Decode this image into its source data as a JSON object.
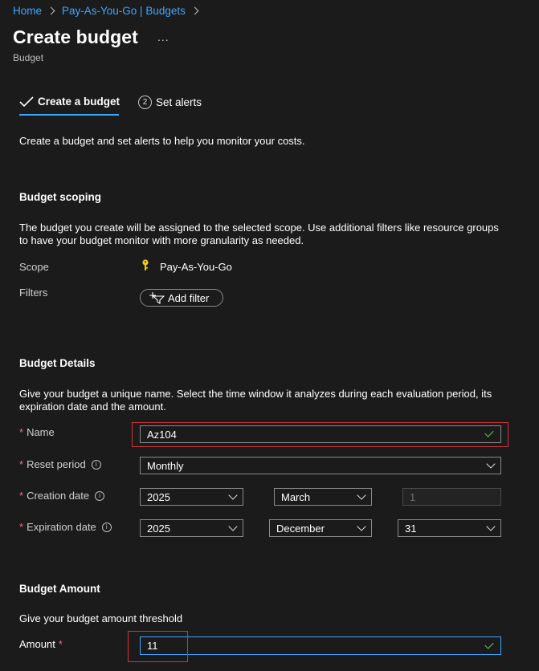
{
  "breadcrumb": {
    "items": [
      "Home",
      "Pay-As-You-Go | Budgets"
    ]
  },
  "header": {
    "title": "Create budget",
    "more": "...",
    "subtitle": "Budget"
  },
  "tabs": [
    {
      "label": "Create a budget",
      "state": "completed"
    },
    {
      "label": "Set alerts",
      "step": "2"
    }
  ],
  "intro": "Create a budget and set alerts to help you monitor your costs.",
  "scoping": {
    "heading": "Budget scoping",
    "description": "The budget you create will be assigned to the selected scope. Use additional filters like resource groups to have your budget monitor with more granularity as needed.",
    "scope_label": "Scope",
    "scope_value": "Pay-As-You-Go",
    "scope_icon": "key-icon",
    "filters_label": "Filters",
    "add_filter_label": "Add filter"
  },
  "details": {
    "heading": "Budget Details",
    "description": "Give your budget a unique name. Select the time window it analyzes during each evaluation period, its expiration date and the amount.",
    "name_label": "Name",
    "name_value": "Az104",
    "reset_label": "Reset period",
    "reset_value": "Monthly",
    "creation_label": "Creation date",
    "creation_year": "2025",
    "creation_month": "March",
    "creation_day": "1",
    "expiration_label": "Expiration date",
    "expiration_year": "2025",
    "expiration_month": "December",
    "expiration_day": "31",
    "required_mark": "*",
    "info_glyph": "i"
  },
  "amount": {
    "heading": "Budget Amount",
    "description": "Give your budget amount threshold",
    "label": "Amount",
    "value": "11"
  },
  "colors": {
    "background": "#1b1b1b",
    "link": "#3ea6ff",
    "required": "#f1707b",
    "valid": "#6ccb5f",
    "highlight": "#d13438",
    "key": "#f2c811"
  }
}
